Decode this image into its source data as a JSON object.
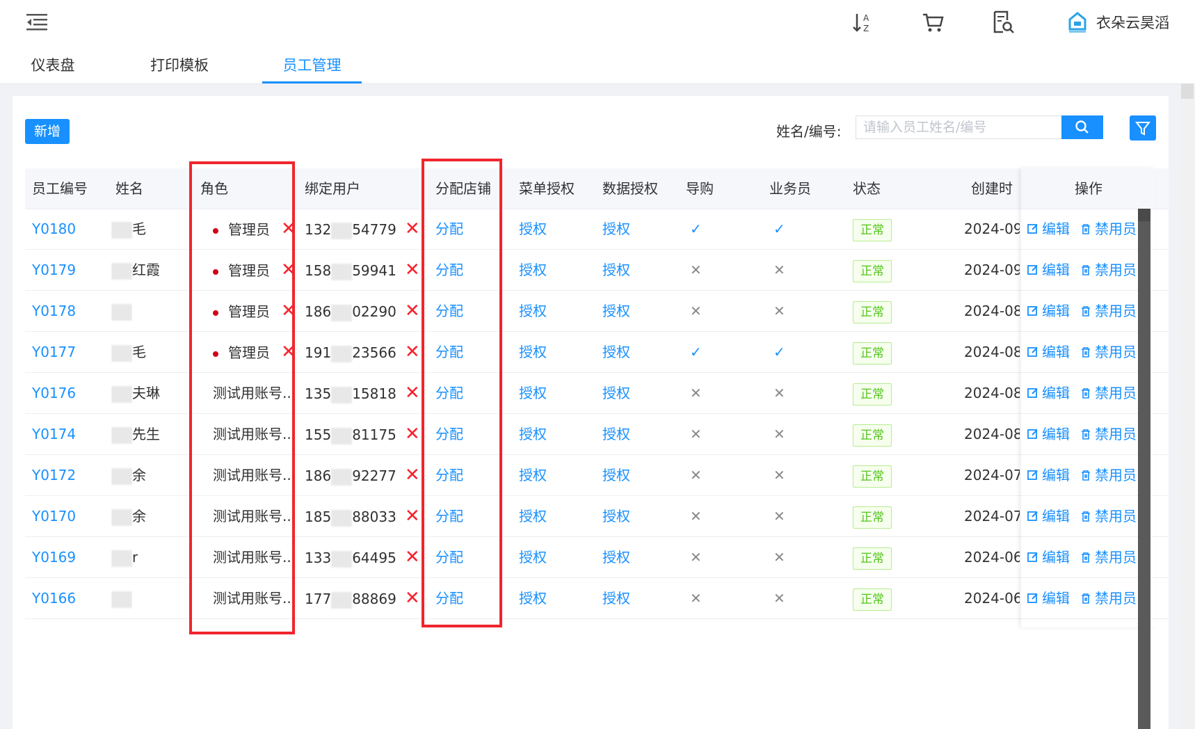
{
  "top": {
    "brand_name": "衣朵云昊滔",
    "icons": [
      "menu-fold-icon",
      "sort-az-icon",
      "cart-icon",
      "search-document-icon",
      "brand-logo-icon"
    ]
  },
  "tabs": [
    {
      "label": "仪表盘",
      "active": false
    },
    {
      "label": "打印模板",
      "active": false
    },
    {
      "label": "员工管理",
      "active": true
    }
  ],
  "toolbar": {
    "add_label": "新增",
    "search_label": "姓名/编号:",
    "search_placeholder": "请输入员工姓名/编号",
    "search_value": ""
  },
  "table": {
    "headers": {
      "id": "员工编号",
      "name": "姓名",
      "role": "角色",
      "bound": "绑定用户",
      "store": "分配店铺",
      "menu": "菜单授权",
      "data": "数据授权",
      "guide": "导购",
      "sales": "业务员",
      "status": "状态",
      "created": "创建时",
      "ops": "操作"
    },
    "rows": [
      {
        "id": "Y0180",
        "name": "毛",
        "role": "管理员",
        "role_dot": true,
        "phone_a": "132",
        "phone_b": "54779",
        "store": "分配",
        "menu": "授权",
        "data": "授权",
        "guide": "✓",
        "sales": "✓",
        "status": "正常",
        "created": "2024-09"
      },
      {
        "id": "Y0179",
        "name": "红霞",
        "role": "管理员",
        "role_dot": true,
        "phone_a": "158",
        "phone_b": "59941",
        "store": "分配",
        "menu": "授权",
        "data": "授权",
        "guide": "✕",
        "sales": "✕",
        "status": "正常",
        "created": "2024-09"
      },
      {
        "id": "Y0178",
        "name": "",
        "role": "管理员",
        "role_dot": true,
        "phone_a": "186",
        "phone_b": "02290",
        "store": "分配",
        "menu": "授权",
        "data": "授权",
        "guide": "✕",
        "sales": "✕",
        "status": "正常",
        "created": "2024-08"
      },
      {
        "id": "Y0177",
        "name": "毛",
        "role": "管理员",
        "role_dot": true,
        "phone_a": "191",
        "phone_b": "23566",
        "store": "分配",
        "menu": "授权",
        "data": "授权",
        "guide": "✓",
        "sales": "✓",
        "status": "正常",
        "created": "2024-08"
      },
      {
        "id": "Y0176",
        "name": "夫琳",
        "role": "测试用账号...",
        "role_dot": false,
        "phone_a": "135",
        "phone_b": "15818",
        "store": "分配",
        "menu": "授权",
        "data": "授权",
        "guide": "✕",
        "sales": "✕",
        "status": "正常",
        "created": "2024-08"
      },
      {
        "id": "Y0174",
        "name": "先生",
        "role": "测试用账号...",
        "role_dot": false,
        "phone_a": "155",
        "phone_b": "81175",
        "store": "分配",
        "menu": "授权",
        "data": "授权",
        "guide": "✕",
        "sales": "✕",
        "status": "正常",
        "created": "2024-08"
      },
      {
        "id": "Y0172",
        "name": "余",
        "role": "测试用账号...",
        "role_dot": false,
        "phone_a": "186",
        "phone_b": "92277",
        "store": "分配",
        "menu": "授权",
        "data": "授权",
        "guide": "✕",
        "sales": "✕",
        "status": "正常",
        "created": "2024-07"
      },
      {
        "id": "Y0170",
        "name": "余",
        "role": "测试用账号...",
        "role_dot": false,
        "phone_a": "185",
        "phone_b": "88033",
        "store": "分配",
        "menu": "授权",
        "data": "授权",
        "guide": "✕",
        "sales": "✕",
        "status": "正常",
        "created": "2024-07"
      },
      {
        "id": "Y0169",
        "name": "r",
        "role": "测试用账号...",
        "role_dot": false,
        "phone_a": "133",
        "phone_b": "64495",
        "store": "分配",
        "menu": "授权",
        "data": "授权",
        "guide": "✕",
        "sales": "✕",
        "status": "正常",
        "created": "2024-06"
      },
      {
        "id": "Y0166",
        "name": "",
        "role": "测试用账号...",
        "role_dot": false,
        "phone_a": "177",
        "phone_b": "88869",
        "store": "分配",
        "menu": "授权",
        "data": "授权",
        "guide": "✕",
        "sales": "✕",
        "status": "正常",
        "created": "2024-06"
      }
    ],
    "ops": {
      "edit": "编辑",
      "disable": "禁用员"
    }
  },
  "colors": {
    "primary": "#1890ff",
    "highlight": "#f0252d",
    "success": "#52c41a"
  }
}
